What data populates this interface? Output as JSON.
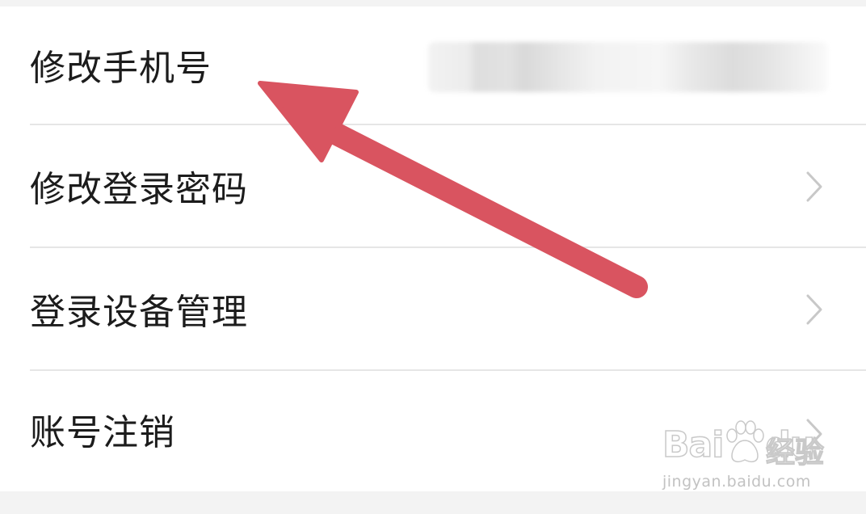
{
  "settings_list": {
    "items": [
      {
        "label": "修改手机号",
        "has_chevron": false,
        "value_blurred": true
      },
      {
        "label": "修改登录密码",
        "has_chevron": true
      },
      {
        "label": "登录设备管理",
        "has_chevron": true
      },
      {
        "label": "账号注销",
        "has_chevron": true
      }
    ]
  },
  "annotation": {
    "arrow_color": "#d95460",
    "points_to": "修改手机号"
  },
  "watermark": {
    "logo_text_left": "Bai",
    "logo_text_right": "du",
    "product": "经验",
    "url": "jingyan.baidu.com"
  },
  "colors": {
    "page_background": "#f3f3f3",
    "list_background": "#ffffff",
    "label_text": "#1c1c1c",
    "divider": "#e6e6e6",
    "chevron": "#c8c8c8"
  },
  "icons": [
    "chevron-right-icon",
    "baidu-paw-icon"
  ]
}
